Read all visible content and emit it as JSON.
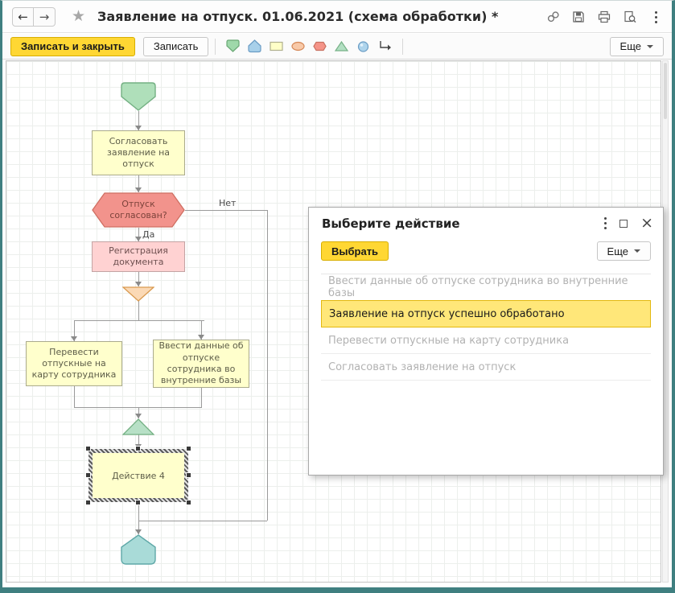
{
  "titlebar": {
    "title": "Заявление на отпуск. 01.06.2021 (схема обработки) *"
  },
  "toolbar": {
    "save_close": "Записать и закрыть",
    "save": "Записать",
    "more": "Еще",
    "shape_tools": [
      "start-shape",
      "end-shape",
      "action-shape",
      "ellipse-shape",
      "condition-shape",
      "merge-shape",
      "decoration-shape",
      "connector-line"
    ]
  },
  "flowchart": {
    "nodes": {
      "approve": {
        "label": "Согласовать заявление на отпуск"
      },
      "decision": {
        "label": "Отпуск согласован?",
        "yes": "Да",
        "no": "Нет"
      },
      "register": {
        "label": "Регистрация документа"
      },
      "transfer": {
        "label": "Перевести отпускные на карту сотрудника"
      },
      "enter_data": {
        "label": "Ввести данные об отпуске сотрудника во внутренние базы"
      },
      "action4": {
        "label": "Действие 4",
        "selected": true
      }
    }
  },
  "dialog": {
    "title": "Выберите действие",
    "select": "Выбрать",
    "more": "Еще",
    "items": [
      {
        "text": "Ввести данные об отпуске сотрудника во внутренние базы",
        "state": "disabled"
      },
      {
        "text": "Заявление на отпуск успешно обработано",
        "state": "selected"
      },
      {
        "text": "Перевести отпускные на карту сотрудника",
        "state": "disabled"
      },
      {
        "text": "Согласовать заявление на отпуск",
        "state": "disabled"
      }
    ]
  },
  "colors": {
    "accent_yellow": "#FFD733",
    "selection_yellow": "#FFE779",
    "selection_border": "#E3B80F",
    "window_frame": "#3F7F80",
    "start_fill": "#AFDFBA",
    "end_fill": "#A9DBD8",
    "action_fill": "#FFFFCC",
    "condition_fill": "#F2938C",
    "register_fill": "#FFD2D2"
  }
}
